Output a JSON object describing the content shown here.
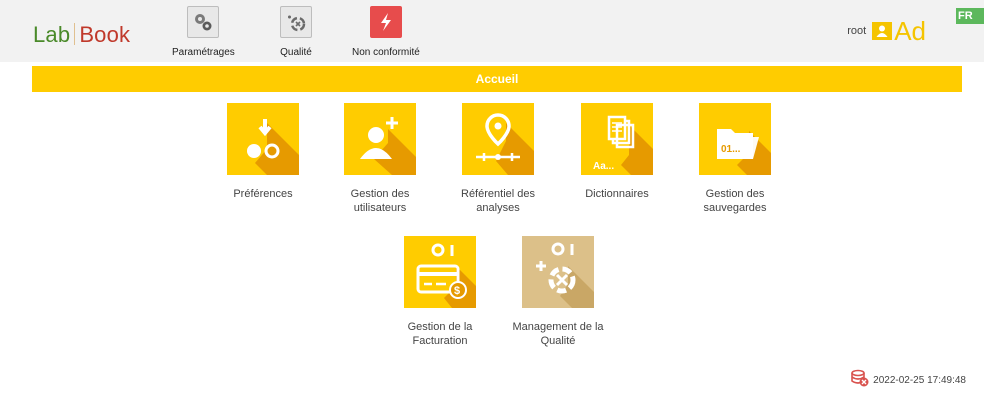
{
  "app": {
    "logo_left": "Lab",
    "logo_right": "Book"
  },
  "nav": {
    "items": [
      {
        "label": "Paramétrages",
        "icon": "gears-icon"
      },
      {
        "label": "Qualité",
        "icon": "quality-icon"
      },
      {
        "label": "Non conformité",
        "icon": "lightning-icon"
      }
    ]
  },
  "user": {
    "name": "root",
    "initials": "Ad",
    "icon": "user-icon"
  },
  "language": "FR",
  "banner": {
    "title": "Accueil"
  },
  "tiles": [
    {
      "label1": "Préférences",
      "label2": "",
      "icon": "preferences-icon"
    },
    {
      "label1": "Gestion des",
      "label2": "utilisateurs",
      "icon": "add-user-icon"
    },
    {
      "label1": "Référentiel des",
      "label2": "analyses",
      "icon": "location-pin-icon"
    },
    {
      "label1": "Dictionnaires",
      "label2": "",
      "icon": "documents-icon",
      "text": "Aa..."
    },
    {
      "label1": "Gestion des",
      "label2": "sauvegardes",
      "icon": "folder-icon",
      "text": "01..."
    },
    {
      "label1": "Gestion de la",
      "label2": "Facturation",
      "icon": "credit-card-icon"
    },
    {
      "label1": "Management de la",
      "label2": "Qualité",
      "icon": "quality-management-icon"
    }
  ],
  "colors": {
    "tile_yellow": "#ffcc00",
    "tile_shadow": "#e69a00",
    "tile_beige": "#dcc089",
    "banner": "#ffcc00",
    "lang_badge": "#5cb85c"
  },
  "footer": {
    "timestamp": "2022-02-25 17:49:48",
    "icon": "database-error-icon"
  }
}
